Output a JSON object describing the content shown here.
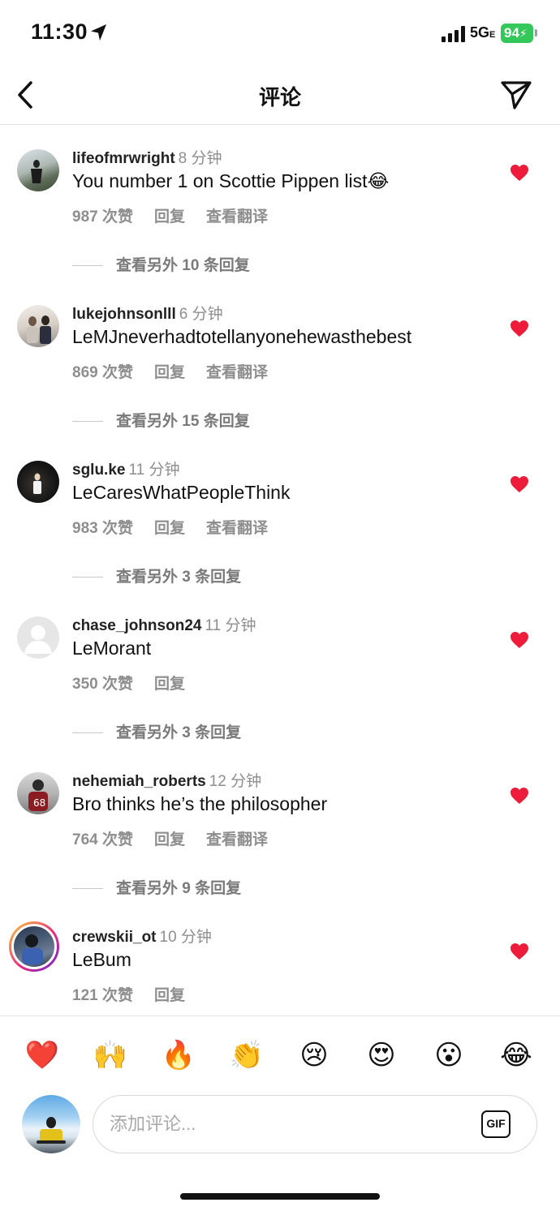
{
  "status_bar": {
    "time": "11:30",
    "network": "5G",
    "network_suffix": "E",
    "battery": "94"
  },
  "nav": {
    "title": "评论"
  },
  "comments": [
    {
      "username": "lifeofmrwright",
      "ago": "8 分钟",
      "text": "You number 1 on Scottie Pippen list😂",
      "likes": "987 次赞",
      "reply": "回复",
      "translate": "查看翻译",
      "more_replies": "查看另外 10 条回复"
    },
    {
      "username": "lukejohnsonlll",
      "ago": "6 分钟",
      "text": "LeMJneverhadtotellanyonehewasthebest",
      "likes": "869 次赞",
      "reply": "回复",
      "translate": "查看翻译",
      "more_replies": "查看另外 15 条回复"
    },
    {
      "username": "sglu.ke",
      "ago": "11 分钟",
      "text": "LeCaresWhatPeopleThink",
      "likes": "983 次赞",
      "reply": "回复",
      "translate": "查看翻译",
      "more_replies": "查看另外 3 条回复"
    },
    {
      "username": "chase_johnson24",
      "ago": "11 分钟",
      "text": "LeMorant",
      "likes": "350 次赞",
      "reply": "回复",
      "more_replies": "查看另外 3 条回复"
    },
    {
      "username": "nehemiah_roberts",
      "ago": "12 分钟",
      "text": "Bro thinks he’s the philosopher",
      "likes": "764 次赞",
      "reply": "回复",
      "translate": "查看翻译",
      "more_replies": "查看另外 9 条回复"
    },
    {
      "username": "crewskii_ot",
      "ago": "10 分钟",
      "text": "LeBum",
      "likes": "121 次赞",
      "reply": "回复"
    }
  ],
  "emoji_bar": [
    "❤️",
    "🙌",
    "🔥",
    "👏",
    "😢",
    "😍",
    "😮",
    "😂"
  ],
  "composer": {
    "placeholder": "添加评论...",
    "gif_label": "GIF"
  },
  "colors": {
    "heart": "#ed1c3a",
    "battery": "#34c759",
    "story_ring": "#ee2a7b"
  },
  "icons": [
    "location-arrow-icon",
    "back-chevron-icon",
    "send-icon",
    "heart-icon",
    "gif-icon"
  ]
}
